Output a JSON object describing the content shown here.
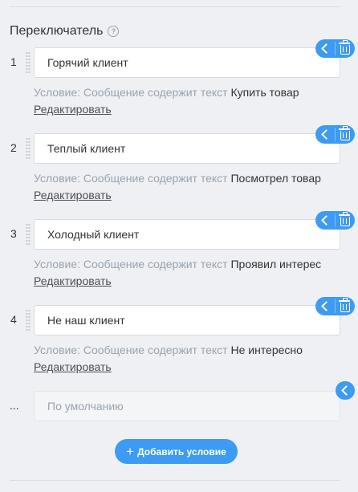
{
  "switch": {
    "title": "Переключатель",
    "help_icon": "?",
    "conditions": [
      {
        "number": "1",
        "value": "Горячий клиент",
        "condition_prefix": "Условие: Сообщение содержит текст",
        "condition_text": "Купить товар",
        "edit_label": "Редактировать"
      },
      {
        "number": "2",
        "value": "Теплый клиент",
        "condition_prefix": "Условие: Сообщение содержит текст",
        "condition_text": "Посмотрел товар",
        "edit_label": "Редактировать"
      },
      {
        "number": "3",
        "value": "Холодный клиент",
        "condition_prefix": "Условие: Сообщение содержит текст",
        "condition_text": "Проявил интерес",
        "edit_label": "Редактировать"
      },
      {
        "number": "4",
        "value": "Не наш клиент",
        "condition_prefix": "Условие: Сообщение содержит текст",
        "condition_text": "Не интересно",
        "edit_label": "Редактировать"
      }
    ],
    "default_row": {
      "number": "...",
      "placeholder": "По умолчанию"
    },
    "add_button": {
      "icon": "+",
      "label": "Добавить условие"
    },
    "colors": {
      "accent": "#3d9bf3",
      "muted_text": "#9aa3ad",
      "text": "#333333"
    }
  }
}
